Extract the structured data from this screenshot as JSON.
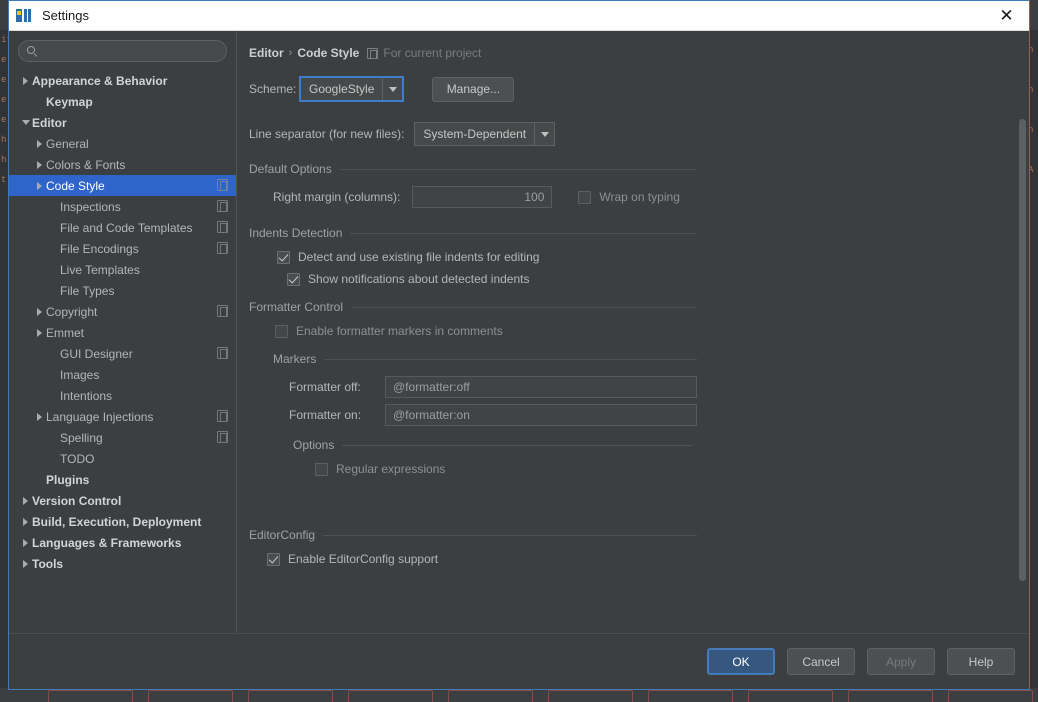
{
  "window": {
    "title": "Settings",
    "app_icon": "intellij-idea-icon",
    "close_label": "✕"
  },
  "sidebar": {
    "search": {
      "value": "",
      "placeholder": "",
      "icon": "search-icon"
    },
    "items": [
      {
        "label": "Appearance & Behavior",
        "arrow": "right",
        "indent": 0,
        "bold": true,
        "scope_icon": false,
        "selected": false
      },
      {
        "label": "Keymap",
        "arrow": "none",
        "indent": 1,
        "bold": true,
        "scope_icon": false,
        "selected": false
      },
      {
        "label": "Editor",
        "arrow": "down",
        "indent": 0,
        "bold": true,
        "scope_icon": false,
        "selected": false
      },
      {
        "label": "General",
        "arrow": "right",
        "indent": 1,
        "bold": false,
        "scope_icon": false,
        "selected": false
      },
      {
        "label": "Colors & Fonts",
        "arrow": "right",
        "indent": 1,
        "bold": false,
        "scope_icon": false,
        "selected": false
      },
      {
        "label": "Code Style",
        "arrow": "right",
        "indent": 1,
        "bold": false,
        "scope_icon": true,
        "selected": true
      },
      {
        "label": "Inspections",
        "arrow": "none",
        "indent": 2,
        "bold": false,
        "scope_icon": true,
        "selected": false
      },
      {
        "label": "File and Code Templates",
        "arrow": "none",
        "indent": 2,
        "bold": false,
        "scope_icon": true,
        "selected": false
      },
      {
        "label": "File Encodings",
        "arrow": "none",
        "indent": 2,
        "bold": false,
        "scope_icon": true,
        "selected": false
      },
      {
        "label": "Live Templates",
        "arrow": "none",
        "indent": 2,
        "bold": false,
        "scope_icon": false,
        "selected": false
      },
      {
        "label": "File Types",
        "arrow": "none",
        "indent": 2,
        "bold": false,
        "scope_icon": false,
        "selected": false
      },
      {
        "label": "Copyright",
        "arrow": "right",
        "indent": 1,
        "bold": false,
        "scope_icon": true,
        "selected": false
      },
      {
        "label": "Emmet",
        "arrow": "right",
        "indent": 1,
        "bold": false,
        "scope_icon": false,
        "selected": false
      },
      {
        "label": "GUI Designer",
        "arrow": "none",
        "indent": 2,
        "bold": false,
        "scope_icon": true,
        "selected": false
      },
      {
        "label": "Images",
        "arrow": "none",
        "indent": 2,
        "bold": false,
        "scope_icon": false,
        "selected": false
      },
      {
        "label": "Intentions",
        "arrow": "none",
        "indent": 2,
        "bold": false,
        "scope_icon": false,
        "selected": false
      },
      {
        "label": "Language Injections",
        "arrow": "right",
        "indent": 1,
        "bold": false,
        "scope_icon": true,
        "selected": false
      },
      {
        "label": "Spelling",
        "arrow": "none",
        "indent": 2,
        "bold": false,
        "scope_icon": true,
        "selected": false
      },
      {
        "label": "TODO",
        "arrow": "none",
        "indent": 2,
        "bold": false,
        "scope_icon": false,
        "selected": false
      },
      {
        "label": "Plugins",
        "arrow": "none",
        "indent": 1,
        "bold": true,
        "scope_icon": false,
        "selected": false
      },
      {
        "label": "Version Control",
        "arrow": "right",
        "indent": 0,
        "bold": true,
        "scope_icon": false,
        "selected": false
      },
      {
        "label": "Build, Execution, Deployment",
        "arrow": "right",
        "indent": 0,
        "bold": true,
        "scope_icon": false,
        "selected": false
      },
      {
        "label": "Languages & Frameworks",
        "arrow": "right",
        "indent": 0,
        "bold": true,
        "scope_icon": false,
        "selected": false
      },
      {
        "label": "Tools",
        "arrow": "right",
        "indent": 0,
        "bold": true,
        "scope_icon": false,
        "selected": false
      }
    ]
  },
  "content": {
    "breadcrumb": {
      "root": "Editor",
      "separator": "›",
      "leaf": "Code Style",
      "scope_icon": "project-scope-icon",
      "note": "For current project"
    },
    "scheme": {
      "label": "Scheme:",
      "value": "GoogleStyle",
      "manage_button": "Manage..."
    },
    "line_separator": {
      "label": "Line separator (for new files):",
      "value": "System-Dependent"
    },
    "default_options": {
      "title": "Default Options",
      "right_margin_label": "Right margin (columns):",
      "right_margin_value": "100",
      "wrap_on_typing_label": "Wrap on typing",
      "wrap_on_typing_checked": false
    },
    "indents_detection": {
      "title": "Indents Detection",
      "detect_label": "Detect and use existing file indents for editing",
      "detect_checked": true,
      "notify_label": "Show notifications about detected indents",
      "notify_checked": true
    },
    "formatter_control": {
      "title": "Formatter Control",
      "enable_label": "Enable formatter markers in comments",
      "enable_checked": false,
      "markers_title": "Markers",
      "off_label": "Formatter off:",
      "off_value": "@formatter:off",
      "on_label": "Formatter on:",
      "on_value": "@formatter:on",
      "options_title": "Options",
      "regex_label": "Regular expressions",
      "regex_checked": false
    },
    "editorconfig": {
      "title": "EditorConfig",
      "enable_label": "Enable EditorConfig support",
      "enable_checked": true
    }
  },
  "footer": {
    "ok": "OK",
    "cancel": "Cancel",
    "apply": "Apply",
    "help": "Help"
  },
  "background": {
    "gutter_marks": [
      "it",
      "e",
      "e",
      "e",
      "e",
      "h",
      "h",
      "t"
    ],
    "right_marks": [
      "n",
      "n",
      "n",
      "A"
    ]
  },
  "colors": {
    "accent": "#2f65ca",
    "primary_button": "#365880",
    "panel": "#3c3f41",
    "field": "#45494a",
    "border": "#5e6264",
    "text": "#b5b5b5",
    "title_bar": "#ffffff",
    "dialog_border": "#3f7cb7"
  }
}
